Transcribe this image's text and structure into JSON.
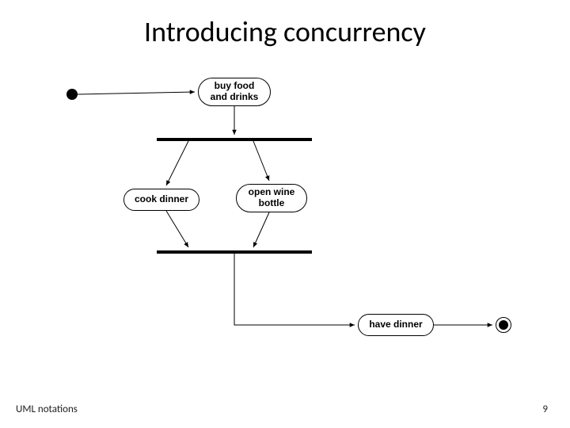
{
  "title": "Introducing concurrency",
  "footer": {
    "left": "UML notations",
    "page": "9"
  },
  "diagram": {
    "nodes": {
      "initial": {
        "type": "initial"
      },
      "buy": {
        "label": "buy food\nand drinks"
      },
      "fork": {
        "type": "bar"
      },
      "cook": {
        "label": "cook dinner"
      },
      "wine": {
        "label": "open wine\nbottle"
      },
      "join": {
        "type": "bar"
      },
      "dinner": {
        "label": "have dinner"
      },
      "final": {
        "type": "final"
      }
    },
    "edges": [
      {
        "from": "initial",
        "to": "buy"
      },
      {
        "from": "buy",
        "to": "fork"
      },
      {
        "from": "fork",
        "to": "cook"
      },
      {
        "from": "fork",
        "to": "wine"
      },
      {
        "from": "cook",
        "to": "join"
      },
      {
        "from": "wine",
        "to": "join"
      },
      {
        "from": "join",
        "to": "dinner"
      },
      {
        "from": "dinner",
        "to": "final"
      }
    ]
  }
}
